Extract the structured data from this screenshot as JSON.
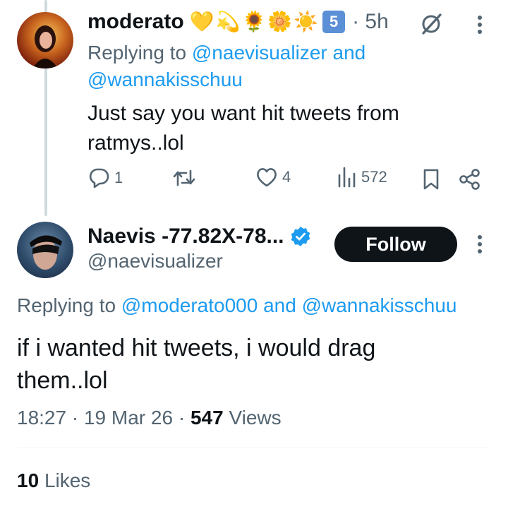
{
  "tweet1": {
    "name": "moderato",
    "emojis": [
      "💛",
      "💫",
      "🌻",
      "🌼",
      "☀️"
    ],
    "keycap": "5",
    "time": "· 5h",
    "replying_prefix": "Replying to",
    "mention1": "@naevisualizer",
    "and": "and",
    "mention2": "@wannakisschuu",
    "text_line1": "Just say you want hit tweets from",
    "text_line2": "ratmys..lol",
    "replies": "1",
    "likes": "4",
    "views": "572"
  },
  "tweet2": {
    "name": "Naevis -77.82X-78...",
    "handle": "@naevisualizer",
    "follow_label": "Follow",
    "replying_prefix": "Replying to",
    "mention1": "@moderato000",
    "and": "and",
    "mention2": "@wannakisschuu",
    "text_line1": "if i wanted hit tweets, i would drag",
    "text_line2": "them..lol",
    "time": "18:27",
    "sep": "·",
    "date": "19 Mar 26",
    "views_count": "547",
    "views_label": "Views",
    "likes_count": "10",
    "likes_label": "Likes"
  },
  "colors": {
    "accent": "#1d9bf0",
    "muted": "#536471",
    "text": "#0f1419",
    "verified": "#1d9bf0"
  },
  "icons": [
    "reply-icon",
    "retweet-icon",
    "like-icon",
    "views-icon",
    "bookmark-icon",
    "share-icon",
    "grok-icon",
    "more-icon",
    "verified-icon"
  ]
}
